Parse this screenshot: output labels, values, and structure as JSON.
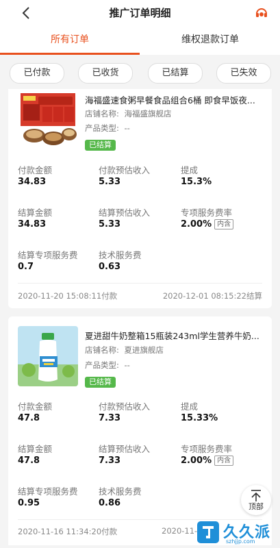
{
  "header": {
    "title": "推广订单明细"
  },
  "tabs": [
    {
      "label": "所有订单"
    },
    {
      "label": "维权退款订单"
    }
  ],
  "filters": [
    {
      "label": "已付款"
    },
    {
      "label": "已收货"
    },
    {
      "label": "已结算"
    },
    {
      "label": "已失效"
    }
  ],
  "orders": [
    {
      "title": "海福盛速食粥早餐食品组合6桶 即食早饭夜...",
      "shop_label": "店铺名称:",
      "shop_name": "海福盛旗舰店",
      "type_label": "产品类型:",
      "type_value": "--",
      "status": "已结算",
      "metrics": [
        {
          "label": "付款金额",
          "value": "34.83"
        },
        {
          "label": "付款预估收入",
          "value": "5.33"
        },
        {
          "label": "提成",
          "value": "15.3%"
        },
        {
          "label": "结算金额",
          "value": "34.83"
        },
        {
          "label": "结算预估收入",
          "value": "5.33"
        },
        {
          "label": "专项服务费率",
          "value": "2.00%",
          "tag": "内含"
        },
        {
          "label": "结算专项服务费",
          "value": "0.7"
        },
        {
          "label": "技术服务费",
          "value": "0.63"
        }
      ],
      "paid_time": "2020-11-20 15:08:11付款",
      "settled_time": "2020-12-01 08:15:22结算"
    },
    {
      "title": "夏进甜牛奶整箱15瓶装243ml学生营养牛奶...",
      "shop_label": "店铺名称:",
      "shop_name": "夏进旗舰店",
      "type_label": "产品类型:",
      "type_value": "--",
      "status": "已结算",
      "metrics": [
        {
          "label": "付款金额",
          "value": "47.8"
        },
        {
          "label": "付款预估收入",
          "value": "7.33"
        },
        {
          "label": "提成",
          "value": "15.33%"
        },
        {
          "label": "结算金额",
          "value": "47.8"
        },
        {
          "label": "结算预估收入",
          "value": "7.33"
        },
        {
          "label": "专项服务费率",
          "value": "2.00%",
          "tag": "内含"
        },
        {
          "label": "结算专项服务费",
          "value": "0.95"
        },
        {
          "label": "技术服务费",
          "value": "0.86"
        }
      ],
      "paid_time": "2020-11-16 11:34:20付款",
      "settled_time": "2020-11-"
    }
  ],
  "top_button": {
    "label": "顶部"
  },
  "watermark": {
    "text": "久久派",
    "sub": "szhjjp.com"
  },
  "colors": {
    "accent": "#e8501e",
    "status_green": "#55b84a"
  }
}
